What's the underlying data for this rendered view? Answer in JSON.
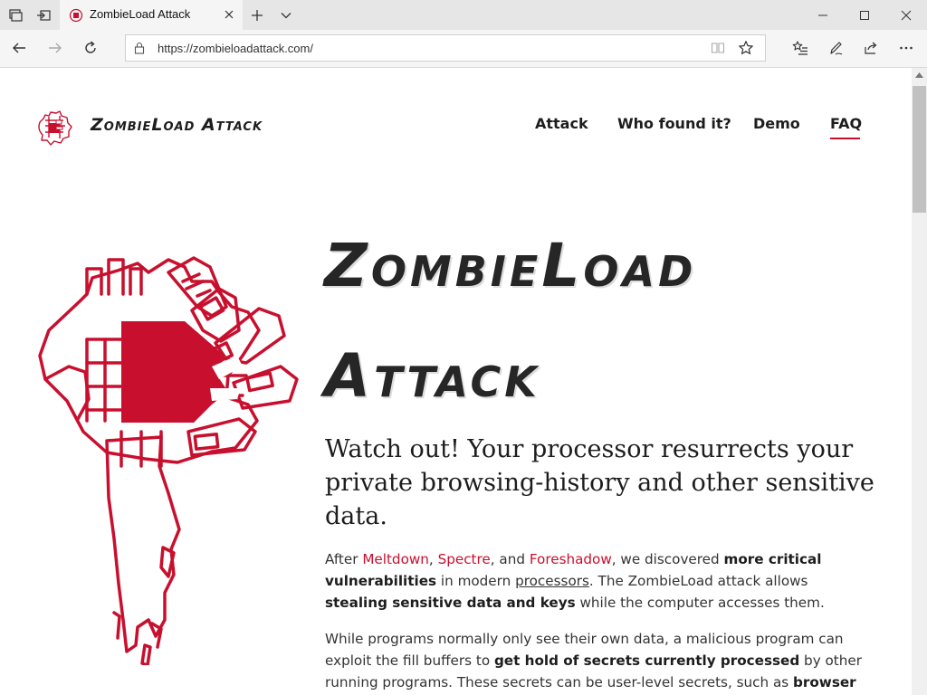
{
  "browser": {
    "tab_title": "ZombieLoad Attack",
    "url": "https://zombieloadattack.com/"
  },
  "site": {
    "name": "ZombieLoad Attack",
    "nav": [
      "Attack",
      "Who found it?",
      "Demo",
      "FAQ"
    ],
    "active_nav": "FAQ"
  },
  "hero": {
    "title_line1": "ZombieLoad",
    "title_line2": "Attack",
    "tagline": "Watch out! Your processor resurrects your private browsing-history and other sensitive data."
  },
  "content": {
    "p1": {
      "s1": "After ",
      "link_meltdown": "Meltdown",
      "s2": ", ",
      "link_spectre": "Spectre",
      "s3": ", and ",
      "link_foreshadow": "Foreshadow",
      "s4": ", we discovered ",
      "b1": "more critical vulnerabilities",
      "s5": " in modern ",
      "link_processors": "processors",
      "s6": ". The ZombieLoad attack allows ",
      "b2": "stealing sensitive data and keys",
      "s7": " while the computer accesses them."
    },
    "p2": {
      "s1": "While programs normally only see their own data, a malicious program can exploit the fill buffers to ",
      "b1": "get hold of secrets currently processed",
      "s2": " by other running programs. These secrets can be user-level secrets, such as ",
      "b2": "browser"
    }
  },
  "colors": {
    "accent": "#c8102e",
    "text": "#1d1d1d",
    "chrome_bg": "#e6e6e6",
    "toolbar_bg": "#f5f5f5"
  },
  "icons": {
    "tab_actions": [
      "tab-list-icon",
      "set-aside-tabs-icon"
    ],
    "nav": [
      "back-arrow-icon",
      "forward-arrow-icon",
      "refresh-icon"
    ],
    "toolbar": [
      "favorites-list-icon",
      "pen-icon",
      "share-icon",
      "more-icon"
    ],
    "window": [
      "minimize-icon",
      "maximize-icon",
      "close-icon"
    ]
  }
}
